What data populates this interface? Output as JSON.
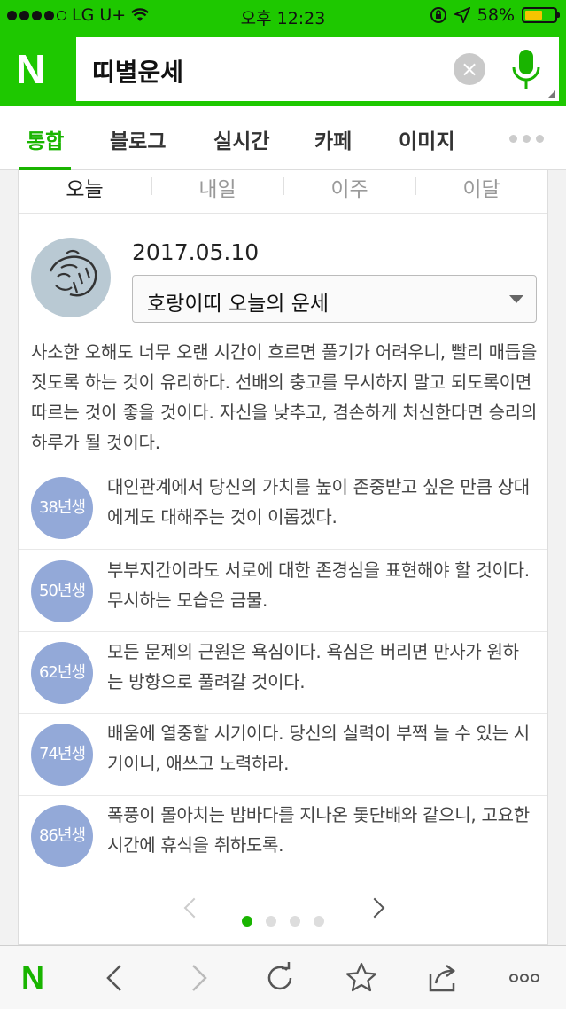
{
  "status_bar": {
    "carrier": "LG U+",
    "time": "오후 12:23",
    "battery_percent": "58%",
    "battery_level": 0.58,
    "signal_dots_filled": 4
  },
  "search": {
    "logo": "N",
    "query": "띠별운세",
    "clear_icon": "clear-icon",
    "mic_icon": "mic-icon"
  },
  "tabs": {
    "items": [
      {
        "label": "통합",
        "active": true
      },
      {
        "label": "블로그"
      },
      {
        "label": "실시간"
      },
      {
        "label": "카페"
      },
      {
        "label": "이미지"
      }
    ],
    "more_icon": "more-dots-icon"
  },
  "fortune": {
    "period_tabs": [
      "오늘",
      "내일",
      "이주",
      "이달"
    ],
    "active_period": "오늘",
    "date": "2017.05.10",
    "selected_zodiac": "호랑이띠 오늘의 운세",
    "main_text": "사소한 오해도 너무 오랜 시간이 흐르면 풀기가 어려우니, 빨리 매듭을 짓도록 하는 것이 유리하다. 선배의 충고를 무시하지 말고 되도록이면 따르는 것이 좋을 것이다. 자신을 낮추고, 겸손하게 처신한다면 승리의 하루가 될 것이다.",
    "by_year": [
      {
        "year": "38년생",
        "text": "대인관계에서 당신의 가치를 높이 존중받고 싶은 만큼 상대에게도 대해주는 것이 이롭겠다."
      },
      {
        "year": "50년생",
        "text": "부부지간이라도 서로에 대한 존경심을 표현해야 할 것이다. 무시하는 모습은 금물."
      },
      {
        "year": "62년생",
        "text": "모든 문제의 근원은 욕심이다. 욕심은 버리면 만사가 원하는 방향으로 풀려갈 것이다."
      },
      {
        "year": "74년생",
        "text": "배움에 열중할 시기이다. 당신의 실력이 부쩍 늘 수 있는 시기이니, 애쓰고 노력하라."
      },
      {
        "year": "86년생",
        "text": "폭풍이 몰아치는 밤바다를 지나온 돛단배와 같으니, 고요한 시간에 휴식을 취하도록."
      }
    ],
    "pager": {
      "total": 4,
      "current": 1
    }
  },
  "toolbar": {
    "logo": "N",
    "icons": [
      "back-icon",
      "forward-icon",
      "refresh-icon",
      "bookmark-star-icon",
      "share-icon",
      "more-icon"
    ]
  },
  "colors": {
    "naver_green": "#1ec800",
    "active_tab": "#19b400",
    "year_badge": "#93a9d8"
  }
}
